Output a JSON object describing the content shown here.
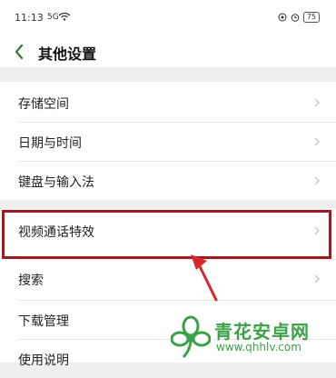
{
  "status_bar": {
    "time": "11:13",
    "signal": "5G",
    "battery": "75"
  },
  "header": {
    "title": "其他设置"
  },
  "settings_group_1": [
    {
      "label": "存储空间"
    },
    {
      "label": "日期与时间"
    },
    {
      "label": "键盘与输入法"
    }
  ],
  "settings_group_2": [
    {
      "label": "视频通话特效"
    },
    {
      "label": "搜索"
    },
    {
      "label": "下载管理"
    },
    {
      "label": "使用说明"
    }
  ],
  "watermark": {
    "text": "青花安卓网",
    "url": "www.qhhlv.com"
  },
  "colors": {
    "highlight": "#9e1b1f",
    "arrow": "#d9262c",
    "watermark": "#3aa148",
    "back_icon": "#2e7d32"
  }
}
